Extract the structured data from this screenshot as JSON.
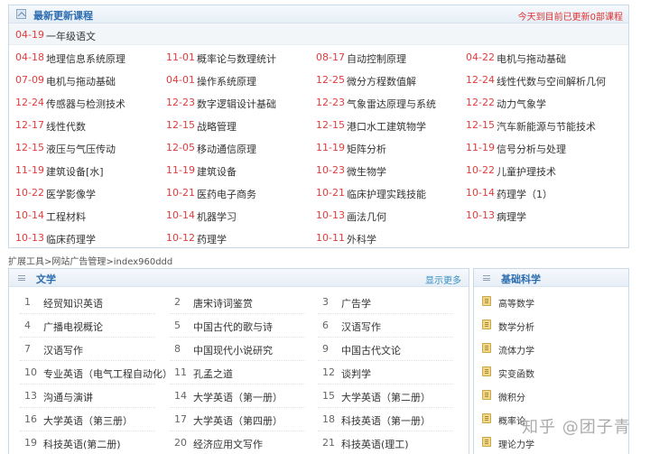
{
  "latest": {
    "title": "最新更新课程",
    "update_notice": "今天到目前已更新0部课程",
    "featured": {
      "date": "04-19",
      "name": "一年级语文"
    },
    "courses": [
      {
        "date": "04-18",
        "name": "地理信息系统原理"
      },
      {
        "date": "11-01",
        "name": "概率论与数理统计"
      },
      {
        "date": "08-17",
        "name": "自动控制原理"
      },
      {
        "date": "04-22",
        "name": "电机与拖动基础"
      },
      {
        "date": "07-09",
        "name": "电机与拖动基础"
      },
      {
        "date": "04-01",
        "name": "操作系统原理"
      },
      {
        "date": "12-25",
        "name": "微分方程数值解"
      },
      {
        "date": "12-24",
        "name": "线性代数与空间解析几何"
      },
      {
        "date": "12-24",
        "name": "传感器与检测技术"
      },
      {
        "date": "12-23",
        "name": "数字逻辑设计基础"
      },
      {
        "date": "12-23",
        "name": "气象雷达原理与系统"
      },
      {
        "date": "12-22",
        "name": "动力气象学"
      },
      {
        "date": "12-17",
        "name": "线性代数"
      },
      {
        "date": "12-15",
        "name": "战略管理"
      },
      {
        "date": "12-15",
        "name": "港口水工建筑物学"
      },
      {
        "date": "12-15",
        "name": "汽车新能源与节能技术"
      },
      {
        "date": "12-15",
        "name": "液压与气压传动"
      },
      {
        "date": "12-05",
        "name": "移动通信原理"
      },
      {
        "date": "11-19",
        "name": "矩阵分析"
      },
      {
        "date": "11-19",
        "name": "信号分析与处理"
      },
      {
        "date": "11-19",
        "name": "建筑设备[水]"
      },
      {
        "date": "11-19",
        "name": "建筑设备"
      },
      {
        "date": "10-23",
        "name": "微生物学"
      },
      {
        "date": "10-22",
        "name": "儿童护理技术"
      },
      {
        "date": "10-22",
        "name": "医学影像学"
      },
      {
        "date": "10-21",
        "name": "医药电子商务"
      },
      {
        "date": "10-21",
        "name": "临床护理实践技能"
      },
      {
        "date": "10-14",
        "name": "药理学（1）"
      },
      {
        "date": "10-14",
        "name": "工程材料"
      },
      {
        "date": "10-14",
        "name": "机器学习"
      },
      {
        "date": "10-13",
        "name": "画法几何"
      },
      {
        "date": "10-13",
        "name": "病理学"
      },
      {
        "date": "10-13",
        "name": "临床药理学"
      },
      {
        "date": "10-12",
        "name": "药理学"
      },
      {
        "date": "10-11",
        "name": "外科学"
      }
    ]
  },
  "breadcrumb": "扩展工具>网站广告管理>index960ddd",
  "literature": {
    "title": "文学",
    "more": "显示更多",
    "items": [
      {
        "num": "1",
        "name": "经贸知识英语"
      },
      {
        "num": "2",
        "name": "唐宋诗词鉴赏"
      },
      {
        "num": "3",
        "name": "广告学"
      },
      {
        "num": "4",
        "name": "广播电视概论"
      },
      {
        "num": "5",
        "name": "中国古代的歌与诗"
      },
      {
        "num": "6",
        "name": "汉语写作"
      },
      {
        "num": "7",
        "name": "汉语写作"
      },
      {
        "num": "8",
        "name": "中国现代小说研究"
      },
      {
        "num": "9",
        "name": "中国古代文论"
      },
      {
        "num": "10",
        "name": "专业英语（电气工程自动化）"
      },
      {
        "num": "11",
        "name": "孔孟之道"
      },
      {
        "num": "12",
        "name": "谈判学"
      },
      {
        "num": "13",
        "name": "沟通与演讲"
      },
      {
        "num": "14",
        "name": "大学英语（第一册）"
      },
      {
        "num": "15",
        "name": "大学英语（第二册）"
      },
      {
        "num": "16",
        "name": "大学英语（第三册）"
      },
      {
        "num": "17",
        "name": "大学英语（第四册）"
      },
      {
        "num": "18",
        "name": "科技英语（第一册）"
      },
      {
        "num": "19",
        "name": "科技英语(第二册)"
      },
      {
        "num": "20",
        "name": "经济应用文写作"
      },
      {
        "num": "21",
        "name": "科技英语(理工)"
      }
    ]
  },
  "science": {
    "title": "基础科学",
    "items": [
      {
        "name": "高等数学"
      },
      {
        "name": "数学分析"
      },
      {
        "name": "流体力学"
      },
      {
        "name": "实变函数"
      },
      {
        "name": "微积分"
      },
      {
        "name": "概率论"
      },
      {
        "name": "理论力学"
      }
    ]
  },
  "watermark": "知乎 @团子青"
}
